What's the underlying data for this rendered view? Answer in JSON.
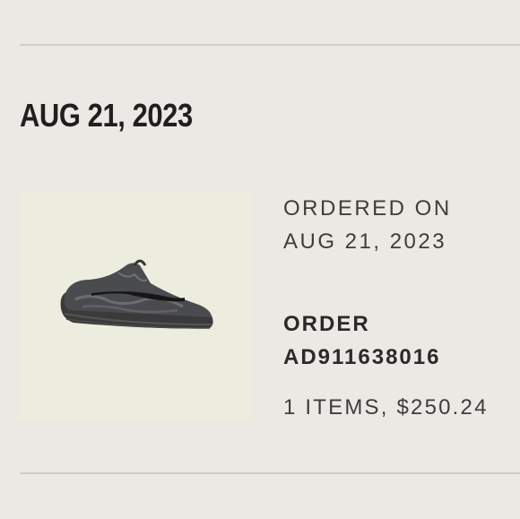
{
  "order": {
    "date_heading": "AUG 21, 2023",
    "ordered_on_label": "ORDERED ON",
    "ordered_on_date": "AUG 21, 2023",
    "order_label": "ORDER",
    "order_number": "AD911638016",
    "summary": "1 ITEMS, $250.24"
  },
  "product": {
    "image": "sneaker-image"
  },
  "colors": {
    "background": "#ece9e5",
    "divider": "#cfccc7",
    "image_bg": "#ecedde",
    "text": "#2b2b2b"
  }
}
